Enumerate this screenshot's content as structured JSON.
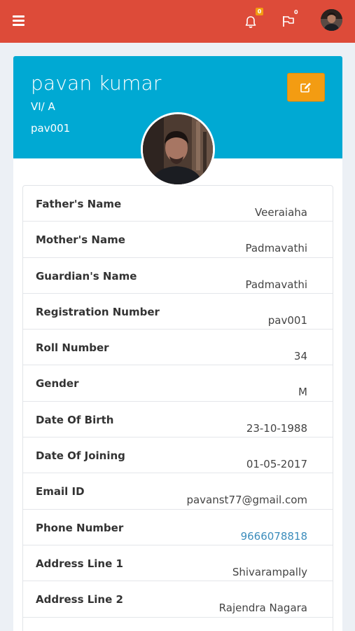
{
  "topbar": {
    "notifications_count": "0",
    "flags_count": "0"
  },
  "profile": {
    "name": "pavan kumar",
    "class_section": "VI/ A",
    "student_id": "pav001"
  },
  "details": [
    {
      "label": "Father's Name",
      "value": "Veeraiaha"
    },
    {
      "label": "Mother's Name",
      "value": "Padmavathi"
    },
    {
      "label": "Guardian's Name",
      "value": "Padmavathi"
    },
    {
      "label": "Registration Number",
      "value": "pav001"
    },
    {
      "label": "Roll Number",
      "value": "34"
    },
    {
      "label": "Gender",
      "value": "M"
    },
    {
      "label": "Date Of Birth",
      "value": "23-10-1988"
    },
    {
      "label": "Date Of Joining",
      "value": "01-05-2017"
    },
    {
      "label": "Email ID",
      "value": "pavanst77@gmail.com"
    },
    {
      "label": "Phone Number",
      "value": "9666078818"
    },
    {
      "label": "Address Line 1",
      "value": "Shivarampally"
    },
    {
      "label": "Address Line 2",
      "value": "Rajendra Nagara"
    },
    {
      "label": "",
      "value": ""
    }
  ],
  "colors": {
    "topbar": "#dd4b39",
    "header": "#00a9d3",
    "edit_button": "#f39c12",
    "link": "#3c8dbc"
  },
  "icons": {
    "menu": "hamburger-icon",
    "notifications": "bell-icon",
    "flags": "flag-icon",
    "edit": "edit-icon"
  }
}
